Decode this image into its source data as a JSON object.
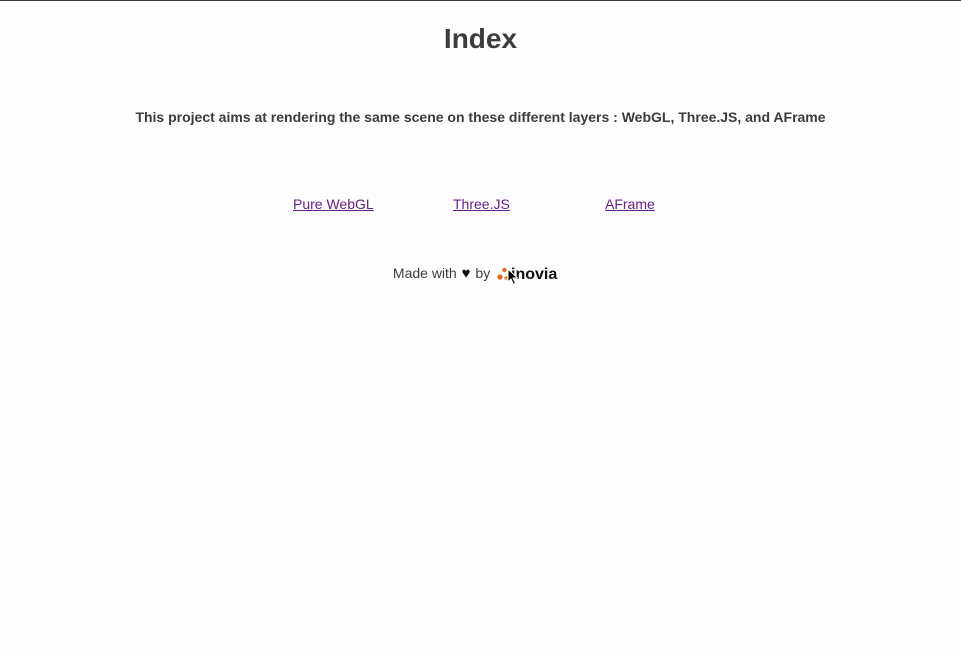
{
  "page": {
    "title": "Index",
    "description": "This project aims at rendering the same scene on these different layers : WebGL, Three.JS, and AFrame"
  },
  "links": [
    {
      "label": "Pure WebGL"
    },
    {
      "label": "Three.JS"
    },
    {
      "label": "AFrame"
    }
  ],
  "footer": {
    "made_with": "Made with",
    "by": "by",
    "logo_text": "inovia",
    "heart_icon": "heart-icon",
    "logo_accent_color": "#e0691c"
  },
  "colors": {
    "text": "#3c3c3c",
    "link": "#6b1f86",
    "background": "#fdfdfd"
  }
}
